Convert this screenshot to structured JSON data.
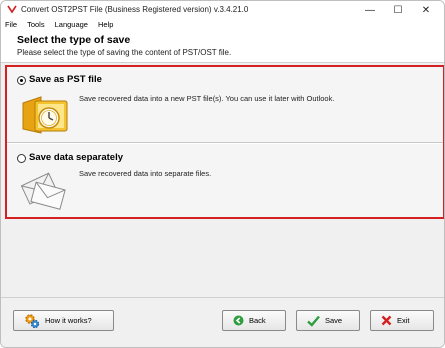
{
  "window": {
    "title": "Convert OST2PST File (Business Registered version) v.3.4.21.0",
    "controls": {
      "minimize": "—",
      "maximize": "☐",
      "close": "✕"
    }
  },
  "menu": [
    "File",
    "Tools",
    "Language",
    "Help"
  ],
  "header": {
    "title": "Select the type of save",
    "subtitle": "Please select the type of saving the content of PST/OST file."
  },
  "options": [
    {
      "label": "Save as PST file",
      "description": "Save recovered data into a new PST file(s). You can use it later with Outlook.",
      "selected": true,
      "icon": "outlook-pst-icon"
    },
    {
      "label": "Save data separately",
      "description": "Save recovered data into separate files.",
      "selected": false,
      "icon": "envelopes-icon"
    }
  ],
  "buttons": {
    "how": "How it works?",
    "back": "Back",
    "save": "Save",
    "exit": "Exit"
  },
  "colors": {
    "highlight_border": "#d32020"
  }
}
